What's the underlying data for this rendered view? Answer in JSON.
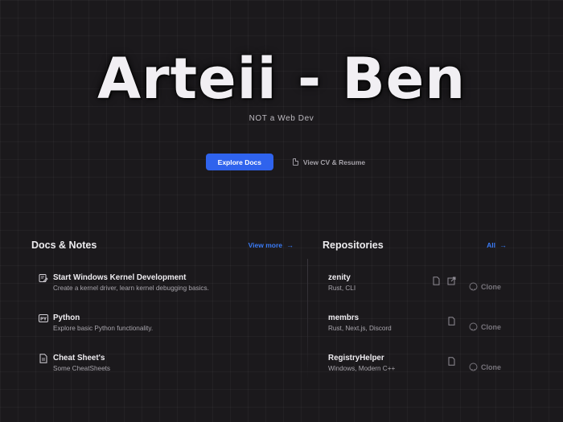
{
  "hero": {
    "title": "Arteii - Ben",
    "subtitle": "NOT a Web Dev"
  },
  "actions": {
    "primary_label": "Explore Docs",
    "secondary_label": "View CV & Resume"
  },
  "docs": {
    "title": "Docs & Notes",
    "link_label": "View more",
    "items": [
      {
        "title": "Start Windows Kernel Development",
        "desc": "Create a kernel driver, learn kernel debugging basics.",
        "icon": "kernel-icon"
      },
      {
        "title": "Python",
        "desc": "Explore basic Python functionality.",
        "icon": "python-icon"
      },
      {
        "title": "Cheat Sheet's",
        "desc": "Some CheatSheets",
        "icon": "document-icon"
      }
    ]
  },
  "repos": {
    "title": "Repositories",
    "link_label": "All",
    "clone_label": "Clone",
    "items": [
      {
        "name": "zenity",
        "tags": "Rust, CLI"
      },
      {
        "name": "membrs",
        "tags": "Rust, Next.js, Discord"
      },
      {
        "name": "RegistryHelper",
        "tags": "Windows, Modern C++"
      }
    ]
  },
  "colors": {
    "background": "#1b191c",
    "accent": "#2f63ed",
    "link": "#3a7bf6"
  }
}
